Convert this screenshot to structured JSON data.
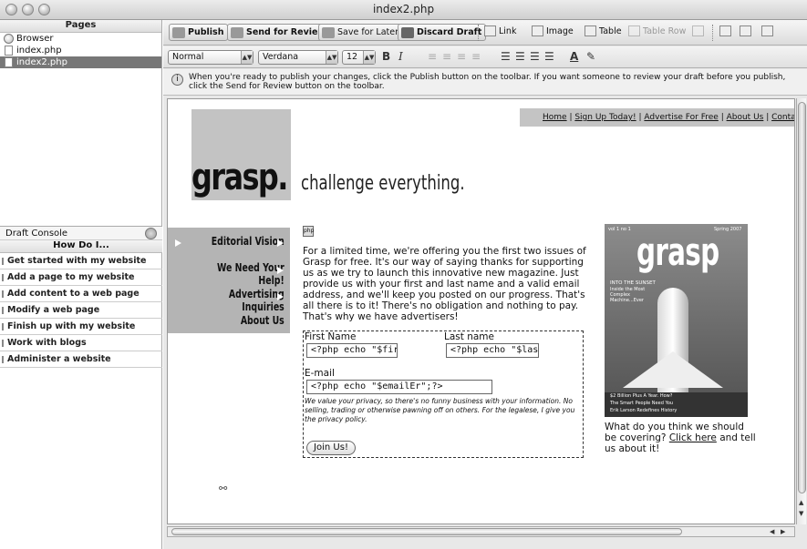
{
  "window": {
    "title": "index2.php"
  },
  "pages_panel": {
    "heading": "Pages",
    "items": [
      {
        "label": "Browser",
        "icon": "globe-icon",
        "selected": false
      },
      {
        "label": "index.php",
        "icon": "file-icon",
        "selected": false
      },
      {
        "label": "index2.php",
        "icon": "file-icon",
        "selected": true
      }
    ]
  },
  "draft_console": {
    "title": "Draft Console",
    "how_do_i": "How Do I...",
    "items": [
      "Get started with my website",
      "Add a page to my website",
      "Add content to a web page",
      "Modify a web page",
      "Finish up with my website",
      "Work with blogs",
      "Administer a website"
    ]
  },
  "toolbar": {
    "publish": "Publish",
    "send_for_review": "Send for Review",
    "save_for_later": "Save for Later",
    "discard_draft": "Discard Draft",
    "link": "Link",
    "image": "Image",
    "table": "Table",
    "table_row": "Table Row"
  },
  "format_bar": {
    "style": "Normal",
    "font": "Verdana",
    "size": "12",
    "bold": "B",
    "italic": "I",
    "text_color": "A"
  },
  "info": {
    "message": "When you're ready to publish your changes, click the Publish button on the toolbar. If you want someone to review your draft before you publish, click the Send for Review button on the toolbar."
  },
  "page": {
    "nav": [
      "Home",
      "Sign Up Today!",
      "Advertise For Free",
      "About Us",
      "Conta"
    ],
    "logo": "grasp.",
    "tagline": "challenge everything.",
    "php_tag": "php",
    "side_nav": [
      "Editorial Vision",
      "We Need Your Help!",
      "Advertising Inquiries",
      "About Us"
    ],
    "intro": "For a limited time, we're offering you the first two issues of Grasp for free. It's our way of saying thanks for supporting us as we try to launch this innovative new magazine. Just provide us with your first and last name and a valid email address, and we'll keep you posted on our progress. That's all there is to it! There's no obligation and nothing to pay. That's why we have advertisers!",
    "form": {
      "first_name_label": "First Name",
      "last_name_label": "Last name",
      "first_name_value": "<?php echo \"$firstE",
      "last_name_value": "<?php echo \"$lastEr",
      "email_label": "E-mail",
      "email_value": "<?php echo \"$emailEr\";?>",
      "privacy": "We value your privacy, so there's no funny business with your information. No selling, trading or otherwise pawning off on others. For the legalese, I give you the privacy policy.",
      "join_button": "Join Us!"
    },
    "magazine": {
      "title": "grasp",
      "vol": "vol 1 no 1",
      "season": "Spring 2007",
      "headline": "INTO THE SUNSET",
      "sub": "Inside the Most Complex Machine...Ever",
      "line1": "$2 Billion Plus A Year. How?",
      "line2": "The Smart People Need You",
      "line3": "Erik Larson Redefines History"
    },
    "caption_before": "What do you think we should be covering?",
    "caption_link": "Click here",
    "caption_after": "and tell us about it!"
  }
}
